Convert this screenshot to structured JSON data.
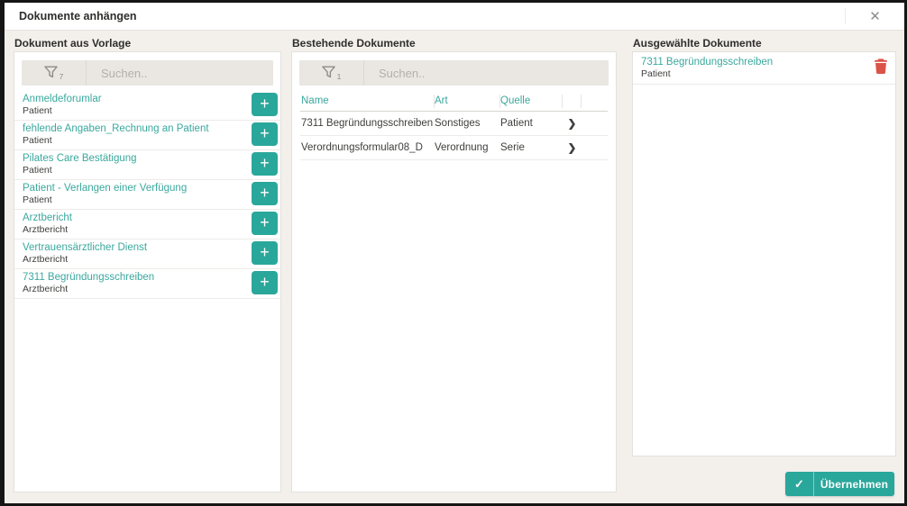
{
  "dialog": {
    "title": "Dokumente anhängen",
    "close_icon": "✕"
  },
  "colors": {
    "accent": "#2aa79b",
    "link": "#3aa89e",
    "danger": "#db5347",
    "background": "#f3f0ec"
  },
  "columns": {
    "templates": {
      "header": "Dokument aus Vorlage",
      "search": {
        "placeholder": "Suchen..",
        "filter_count": "7"
      },
      "add_label": "+",
      "items": [
        {
          "title": "Anmeldeforumlar",
          "subtitle": "Patient"
        },
        {
          "title": "fehlende Angaben_Rechnung an Patient",
          "subtitle": "Patient"
        },
        {
          "title": "Pilates Care Bestätigung",
          "subtitle": "Patient"
        },
        {
          "title": "Patient - Verlangen einer Verfügung",
          "subtitle": "Patient"
        },
        {
          "title": "Arztbericht",
          "subtitle": "Arztbericht"
        },
        {
          "title": "Vertrauensärztlicher Dienst",
          "subtitle": "Arztbericht"
        },
        {
          "title": "7311 Begründungsschreiben",
          "subtitle": "Arztbericht"
        }
      ]
    },
    "existing": {
      "header": "Bestehende Dokumente",
      "search": {
        "placeholder": "Suchen..",
        "filter_count": "1"
      },
      "table": {
        "headers": {
          "name": "Name",
          "art": "Art",
          "quelle": "Quelle"
        },
        "chevron": "❯",
        "rows": [
          {
            "name": "7311 Begründungsschreiben",
            "art": "Sonstiges",
            "quelle": "Patient"
          },
          {
            "name": "Verordnungsformular08_D",
            "art": "Verordnung",
            "quelle": "Serie"
          }
        ]
      }
    },
    "selected": {
      "header": "Ausgewählte Dokumente",
      "items": [
        {
          "title": "7311 Begründungsschreiben",
          "subtitle": "Patient"
        }
      ]
    }
  },
  "footer": {
    "apply_label": "Übernehmen",
    "check_icon": "✓"
  }
}
